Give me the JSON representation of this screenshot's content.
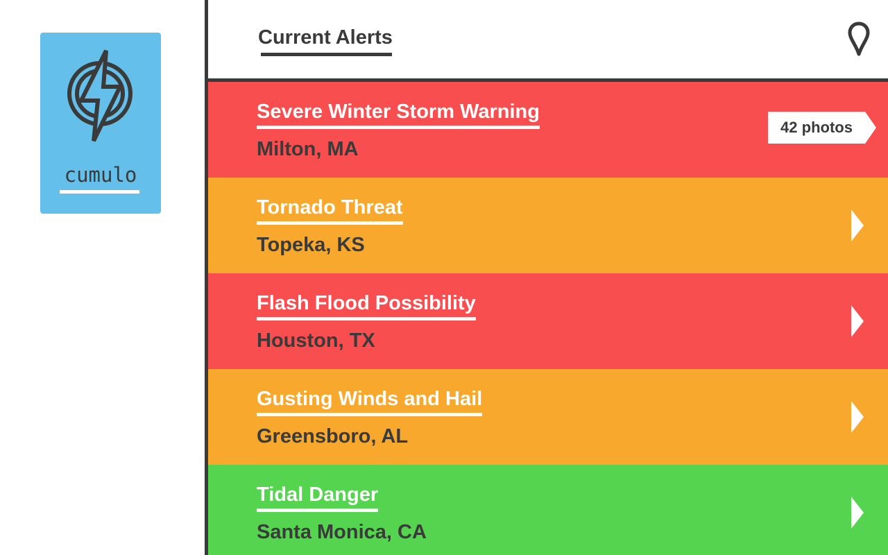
{
  "app": {
    "name": "cumulo",
    "logo_color": "#64c0ea"
  },
  "header": {
    "title": "Current Alerts",
    "location_icon": "map-pin-icon"
  },
  "colors": {
    "warning_red": "#f94e4f",
    "threat_orange": "#f7a82d",
    "safe_green": "#55d54f",
    "dark": "#3a3a3a"
  },
  "alerts": [
    {
      "title": "Severe Winter Storm Warning",
      "location": "Milton, MA",
      "color": "#f94e4f",
      "photos_label": "42 photos"
    },
    {
      "title": "Tornado Threat",
      "location": "Topeka, KS",
      "color": "#f7a82d"
    },
    {
      "title": "Flash Flood Possibility",
      "location": "Houston, TX",
      "color": "#f94e4f"
    },
    {
      "title": "Gusting Winds and Hail",
      "location": "Greensboro, AL",
      "color": "#f7a82d"
    },
    {
      "title": "Tidal Danger",
      "location": "Santa Monica, CA",
      "color": "#55d54f"
    }
  ]
}
